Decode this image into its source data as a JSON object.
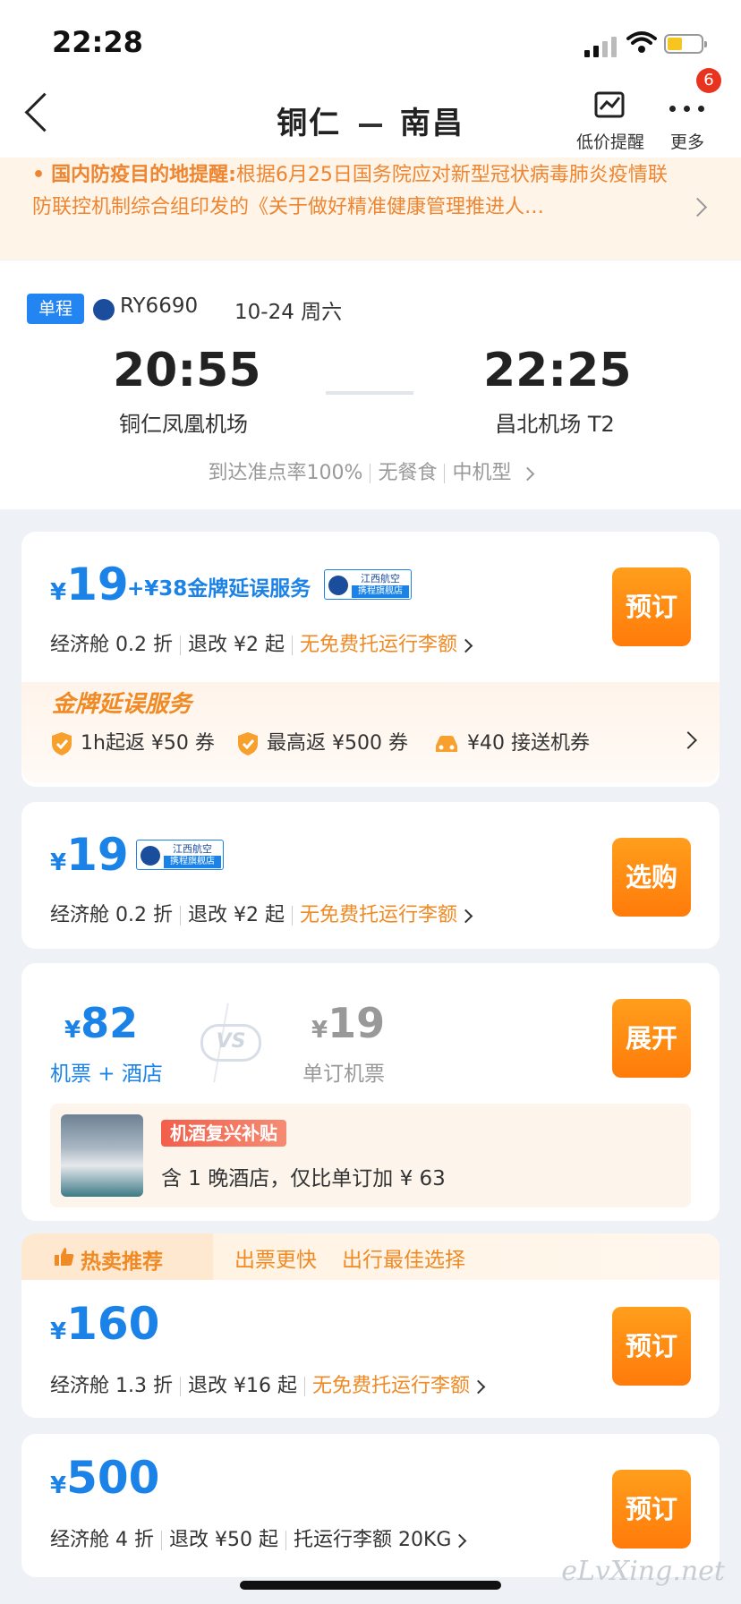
{
  "status_bar": {
    "time": "22:28"
  },
  "nav": {
    "title": "铜仁 ➖ 南昌",
    "title_from": "铜仁",
    "title_to": "南昌",
    "low_price_label": "低价提醒",
    "more_label": "更多",
    "more_badge": "6"
  },
  "notice": {
    "bullet": "•",
    "highlight": "国内防疫目的地提醒:",
    "text": "根据6月25日国务院应对新型冠状病毒肺炎疫情联防联控机制综合组印发的《关于做好精准健康管理推进人…"
  },
  "flight": {
    "tag": "单程",
    "number": "RY6690",
    "date": "10-24 周六",
    "dep_time": "20:55",
    "dep_airport": "铜仁凤凰机场",
    "arr_time": "22:25",
    "arr_airport": "昌北机场 T2",
    "meta": [
      "到达准点率100%",
      "无餐食",
      "中机型"
    ]
  },
  "shop_badge": {
    "line1": "江西航空",
    "line2": "携程旗舰店"
  },
  "offers": [
    {
      "yen": "¥",
      "price": "19",
      "addon": "+¥38金牌延误服务",
      "cabin": "经济舱 0.2 折",
      "refund": "退改 ¥2 起",
      "baggage": "无免费托运行李额",
      "button": "预订",
      "gold": {
        "title": "金牌延误服务",
        "perks": [
          "1h起返 ¥50 券",
          "最高返 ¥500 券",
          "¥40 接送机券"
        ]
      }
    },
    {
      "yen": "¥",
      "price": "19",
      "cabin": "经济舱 0.2 折",
      "refund": "退改 ¥2 起",
      "baggage": "无免费托运行李额",
      "button": "选购"
    },
    {
      "yen": "¥",
      "price": "160",
      "cabin": "经济舱 1.3 折",
      "refund": "退改 ¥16 起",
      "baggage": "无免费托运行李额",
      "button": "预订"
    },
    {
      "yen": "¥",
      "price": "500",
      "cabin": "经济舱 4 折",
      "refund": "退改 ¥50 起",
      "baggage": "托运行李额 20KG",
      "button": "预订"
    }
  ],
  "bundle": {
    "yen": "¥",
    "price": "82",
    "label": "机票 + 酒店",
    "vs": "VS",
    "alt_yen": "¥",
    "alt_price": "19",
    "alt_label": "单订机票",
    "button": "展开",
    "subsidy": "机酒复兴补贴",
    "hotel_text": "含 1 晚酒店，仅比单订加 ¥ 63"
  },
  "hot": {
    "title": "热卖推荐",
    "tags": [
      "出票更快",
      "出行最佳选择"
    ]
  },
  "watermark": "eLvXing.net",
  "colors": {
    "accent": "#1b83e8",
    "orange": "#ff8a12",
    "notice": "#ee8530"
  }
}
